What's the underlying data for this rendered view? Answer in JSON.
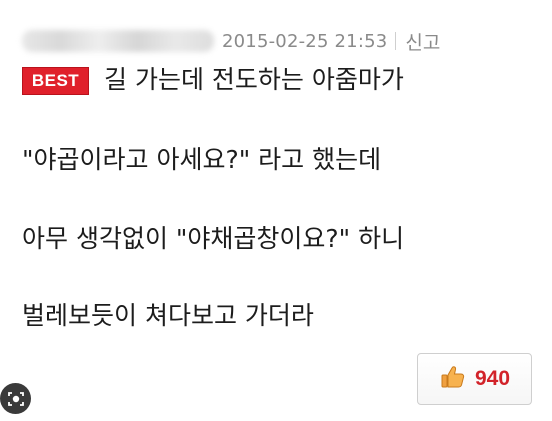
{
  "comment": {
    "timestamp": "2015-02-25 21:53",
    "report_label": "신고",
    "badge_label": "BEST",
    "lines": [
      "길 가는데 전도하는 아줌마가",
      "\"야곱이라고 아세요?\" 라고 했는데",
      "아무 생각없이 \"야채곱창이요?\" 하니",
      "벌레보듯이 쳐다보고 가더라"
    ],
    "like_count": "940",
    "colors": {
      "badge": "#e0202b",
      "like_count": "#d2232a",
      "meta_text": "#8a8a8a"
    }
  },
  "icons": {
    "like": "thumbs-up-icon",
    "lens": "camera-lens-icon"
  }
}
